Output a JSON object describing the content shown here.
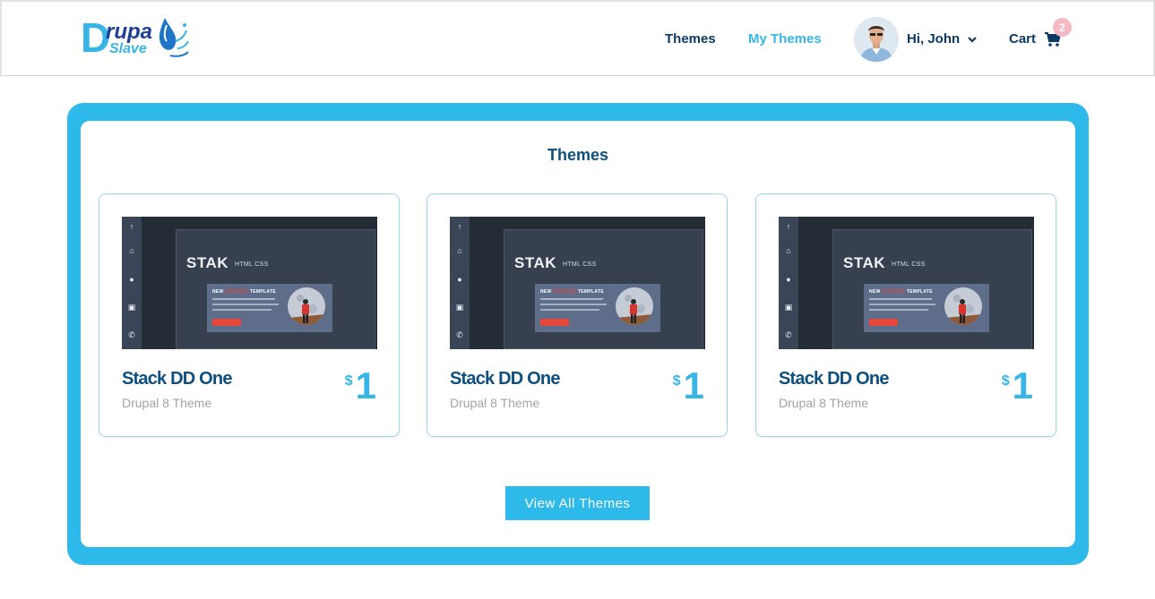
{
  "brand": {
    "logo_initial": "D",
    "logo_line1": "rupa",
    "logo_line2": "Slave"
  },
  "nav": {
    "themes": "Themes",
    "my_themes": "My Themes",
    "greeting": "Hi, John",
    "cart": "Cart",
    "cart_count": "2"
  },
  "main": {
    "title": "Themes",
    "cards": [
      {
        "thumb_title": "STAK",
        "thumb_sub": "HTML CSS",
        "thumb_inner_pre": "NEW",
        "thumb_inner_red": "STACKED",
        "thumb_inner_post": "TEMPLATE",
        "name": "Stack DD One",
        "subtitle": "Drupal 8 Theme",
        "currency": "$",
        "price": "1"
      },
      {
        "thumb_title": "STAK",
        "thumb_sub": "HTML CSS",
        "thumb_inner_pre": "NEW",
        "thumb_inner_red": "STACKED",
        "thumb_inner_post": "TEMPLATE",
        "name": "Stack DD One",
        "subtitle": "Drupal 8 Theme",
        "currency": "$",
        "price": "1"
      },
      {
        "thumb_title": "STAK",
        "thumb_sub": "HTML CSS",
        "thumb_inner_pre": "NEW",
        "thumb_inner_red": "STACKED",
        "thumb_inner_post": "TEMPLATE",
        "name": "Stack DD One",
        "subtitle": "Drupal 8 Theme",
        "currency": "$",
        "price": "1"
      }
    ],
    "view_all": "View All Themes"
  },
  "colors": {
    "accent": "#2dbaea",
    "navy": "#0d4f7f",
    "badge": "#f6b9c4"
  },
  "icons": {
    "cart": "cart-icon",
    "chevron": "chevron-down-icon",
    "logo_drop": "water-drop-icon"
  }
}
